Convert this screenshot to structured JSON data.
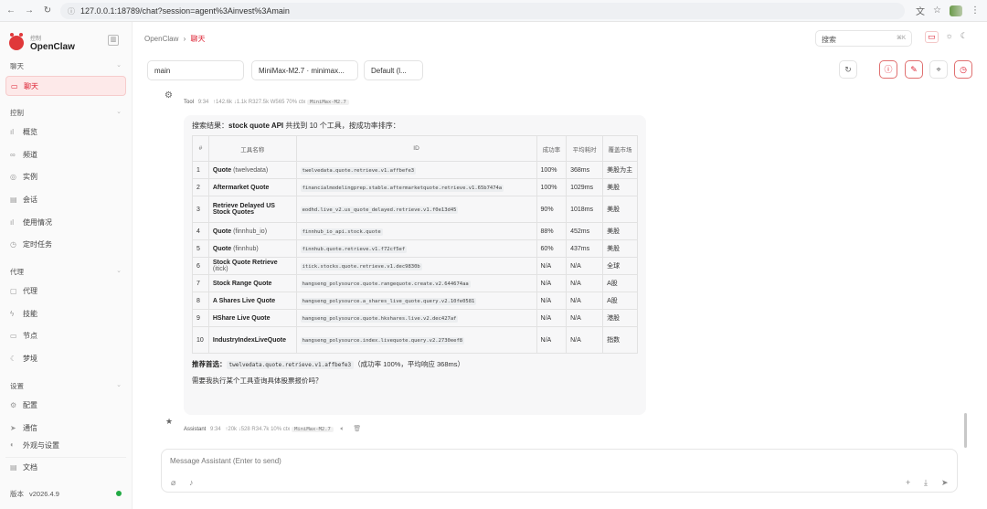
{
  "browser": {
    "url": "127.0.0.1:18789/chat?session=agent%3Ainvest%3Amain",
    "nav_icons": [
      "back-icon",
      "forward-icon",
      "reload-icon"
    ]
  },
  "sidebar": {
    "brand_small": "控制",
    "brand_name": "OpenClaw",
    "sections": [
      {
        "label": "聊天"
      },
      {
        "label": "控制"
      },
      {
        "label": "代理"
      },
      {
        "label": "设置"
      }
    ],
    "chat_item": "聊天",
    "control_items": [
      "概览",
      "频道",
      "实例",
      "会话",
      "使用情况",
      "定时任务"
    ],
    "agent_items": [
      "代理",
      "技能",
      "节点",
      "梦境"
    ],
    "settings_items": [
      "配置",
      "通信",
      "外观与设置"
    ],
    "docs": "文档",
    "version_label": "版本",
    "version": "v2026.4.9",
    "status_color": "#22aa44"
  },
  "topbar": {
    "crumb_root": "OpenClaw",
    "crumb_sep": "›",
    "crumb_current": "聊天",
    "search_placeholder": "搜索",
    "search_shortcut": "⌘K"
  },
  "controls": {
    "session": "main",
    "model": "MiniMax-M2.7 · minimax...",
    "thinking": "Default (l..."
  },
  "tool_meta": {
    "role": "Tool",
    "time": "9:34",
    "stats": "↑142.6k ↓1.1k R327.5k W565 70% ctx",
    "model": "MiniMax-M2.7"
  },
  "message": {
    "intro_prefix": "搜索结果：",
    "intro_bold": "stock quote API",
    "intro_suffix": " 共找到 10 个工具，按成功率排序：",
    "headers": [
      "#",
      "工具名称",
      "ID",
      "成功率",
      "平均耗时",
      "覆盖市场"
    ],
    "rows": [
      {
        "n": "1",
        "name": "Quote",
        "sub": "(twelvedata)",
        "id": "twelvedata.quote.retrieve.v1.affbefe3",
        "rate": "100%",
        "lat": "368ms",
        "market": "美股为主"
      },
      {
        "n": "2",
        "name": "Aftermarket Quote",
        "sub": "",
        "id": "financialmodelingprep.stable.aftermarketquote.retrieve.v1.65b7474a",
        "rate": "100%",
        "lat": "1029ms",
        "market": "美股"
      },
      {
        "n": "3",
        "name": "Retrieve Delayed US Stock Quotes",
        "sub": "",
        "id": "eodhd.live_v2.us_quote_delayed.retrieve.v1.f0e13d45",
        "rate": "90%",
        "lat": "1018ms",
        "market": "美股"
      },
      {
        "n": "4",
        "name": "Quote",
        "sub": "(finnhub_io)",
        "id": "finnhub_io_api.stock.quote",
        "rate": "88%",
        "lat": "452ms",
        "market": "美股"
      },
      {
        "n": "5",
        "name": "Quote",
        "sub": "(finnhub)",
        "id": "finnhub.quote.retrieve.v1.f72cf5ef",
        "rate": "60%",
        "lat": "437ms",
        "market": "美股"
      },
      {
        "n": "6",
        "name": "Stock Quote Retrieve",
        "sub": "(itick)",
        "id": "itick.stocks.quote.retrieve.v1.dec9830b",
        "rate": "N/A",
        "lat": "N/A",
        "market": "全球"
      },
      {
        "n": "7",
        "name": "Stock Range Quote",
        "sub": "",
        "id": "hangseng_polysource.quote.rangequote.create.v2.644674aa",
        "rate": "N/A",
        "lat": "N/A",
        "market": "A股"
      },
      {
        "n": "8",
        "name": "A Shares Live Quote",
        "sub": "",
        "id": "hangseng_polysource.a_shares_live_quote.query.v2.10fe0581",
        "rate": "N/A",
        "lat": "N/A",
        "market": "A股"
      },
      {
        "n": "9",
        "name": "HShare Live Quote",
        "sub": "",
        "id": "hangseng_polysource.quote.hkshares.live.v2.dec427af",
        "rate": "N/A",
        "lat": "N/A",
        "market": "港股"
      },
      {
        "n": "10",
        "name": "IndustryIndexLiveQuote",
        "sub": "",
        "id": "hangseng_polysource.index.livequote.query.v2.2730eef8",
        "rate": "N/A",
        "lat": "N/A",
        "market": "指数"
      }
    ],
    "rec_label": "推荐首选",
    "rec_colon": "：",
    "rec_id": "twelvedata.quote.retrieve.v1.affbefe3",
    "rec_note": "（成功率 100%，平均响应 368ms）",
    "question": "需要我执行某个工具查询具体股票报价吗？"
  },
  "assistant_meta": {
    "role": "Assistant",
    "time": "9:34",
    "stats": "↑20k ↓528 R34.7k 10% ctx",
    "model": "MiniMax-M2.7"
  },
  "composer": {
    "placeholder": "Message Assistant (Enter to send)"
  }
}
